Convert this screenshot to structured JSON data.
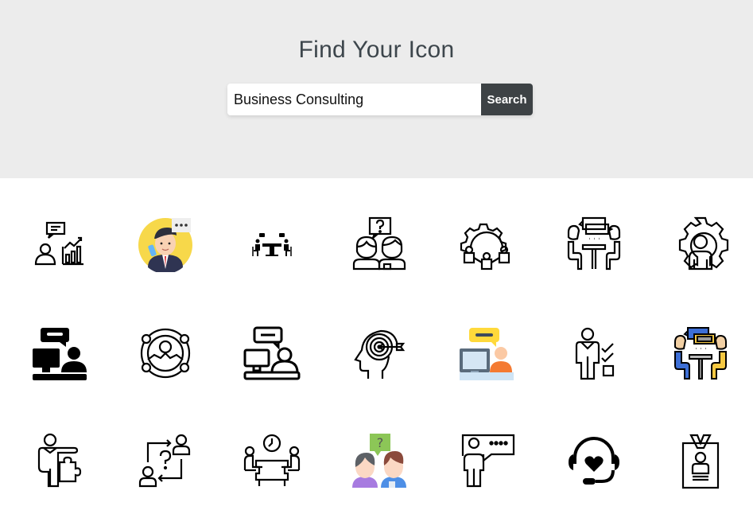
{
  "header": {
    "title": "Find Your Icon"
  },
  "search": {
    "value": "Business Consulting",
    "button_label": "Search"
  },
  "colors": {
    "hero_bg": "#ececec",
    "title": "#3d464c",
    "button_bg": "#3d4245",
    "button_text": "#ffffff"
  },
  "icons": [
    {
      "name": "consultant-chart-icon",
      "row": 0,
      "col": 0
    },
    {
      "name": "businessman-phone-icon",
      "row": 0,
      "col": 1
    },
    {
      "name": "meeting-table-icon",
      "row": 0,
      "col": 2
    },
    {
      "name": "people-question-icon",
      "row": 0,
      "col": 3
    },
    {
      "name": "gear-team-icon",
      "row": 0,
      "col": 4
    },
    {
      "name": "meeting-discussion-icon",
      "row": 0,
      "col": 5
    },
    {
      "name": "gear-person-icon",
      "row": 0,
      "col": 6
    },
    {
      "name": "online-consulting-solid-icon",
      "row": 1,
      "col": 0
    },
    {
      "name": "profile-network-icon",
      "row": 1,
      "col": 1
    },
    {
      "name": "online-consulting-outline-icon",
      "row": 1,
      "col": 2
    },
    {
      "name": "head-target-icon",
      "row": 1,
      "col": 3
    },
    {
      "name": "online-consulting-color-icon",
      "row": 1,
      "col": 4
    },
    {
      "name": "person-checklist-icon",
      "row": 1,
      "col": 5
    },
    {
      "name": "meeting-discussion-color-icon",
      "row": 1,
      "col": 6
    },
    {
      "name": "person-puzzle-icon",
      "row": 2,
      "col": 0
    },
    {
      "name": "exchange-question-icon",
      "row": 2,
      "col": 1
    },
    {
      "name": "meeting-clock-icon",
      "row": 2,
      "col": 2
    },
    {
      "name": "people-question-color-icon",
      "row": 2,
      "col": 3
    },
    {
      "name": "presenter-speech-icon",
      "row": 2,
      "col": 4
    },
    {
      "name": "headset-heart-icon",
      "row": 2,
      "col": 5
    },
    {
      "name": "id-badge-icon",
      "row": 2,
      "col": 6
    }
  ]
}
